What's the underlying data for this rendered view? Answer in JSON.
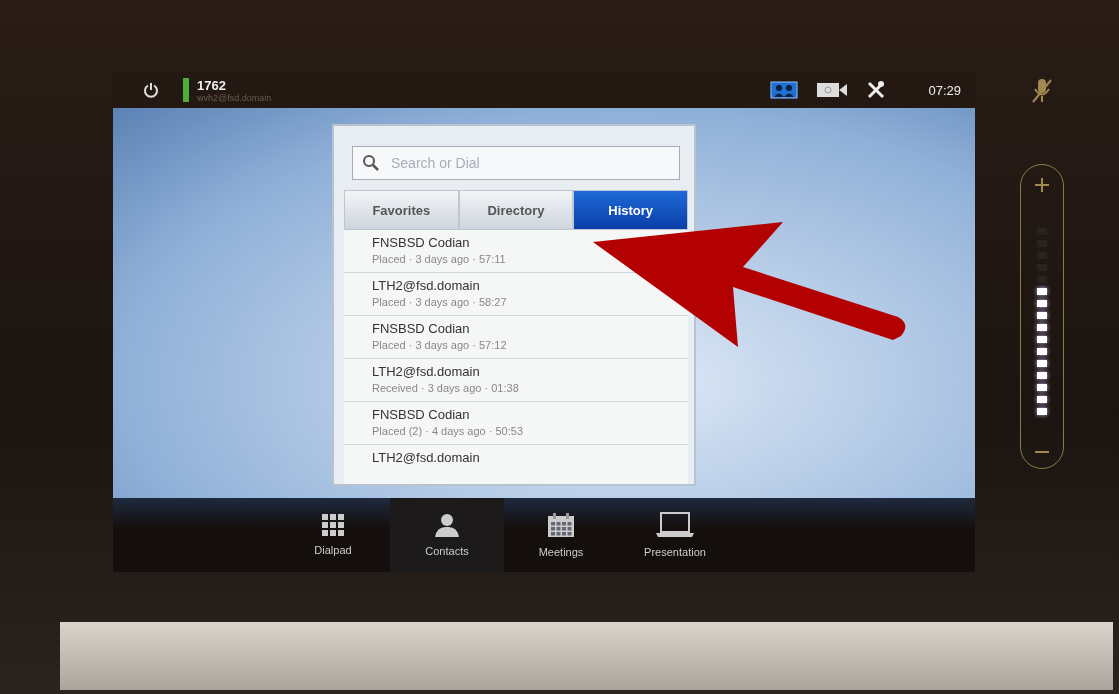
{
  "status_bar": {
    "number": "1762",
    "address": "wvh2@fsd.domain",
    "time": "07:29",
    "selfview_on": true
  },
  "search": {
    "placeholder": "Search or Dial"
  },
  "tabs": [
    {
      "label": "Favorites",
      "selected": false
    },
    {
      "label": "Directory",
      "selected": false
    },
    {
      "label": "History",
      "selected": true
    }
  ],
  "history": [
    {
      "name": "FNSBSD Codian",
      "detail": "Placed · 3 days ago · 57:11"
    },
    {
      "name": "LTH2@fsd.domain",
      "detail": "Placed · 3 days ago · 58:27"
    },
    {
      "name": "FNSBSD Codian",
      "detail": "Placed · 3 days ago · 57:12"
    },
    {
      "name": "LTH2@fsd.domain",
      "detail": "Received · 3 days ago · 01:38"
    },
    {
      "name": "FNSBSD Codian",
      "detail": "Placed (2) · 4 days ago · 50:53"
    },
    {
      "name": "LTH2@fsd.domain"
    }
  ],
  "dock": [
    {
      "kind": "dialpad",
      "label": "Dialpad",
      "selected": false
    },
    {
      "kind": "contacts",
      "label": "Contacts",
      "selected": true
    },
    {
      "kind": "meetings",
      "label": "Meetings",
      "selected": false
    },
    {
      "kind": "presentation",
      "label": "Presentation",
      "selected": false
    }
  ],
  "volume": {
    "level": 0.69,
    "muted": true
  }
}
